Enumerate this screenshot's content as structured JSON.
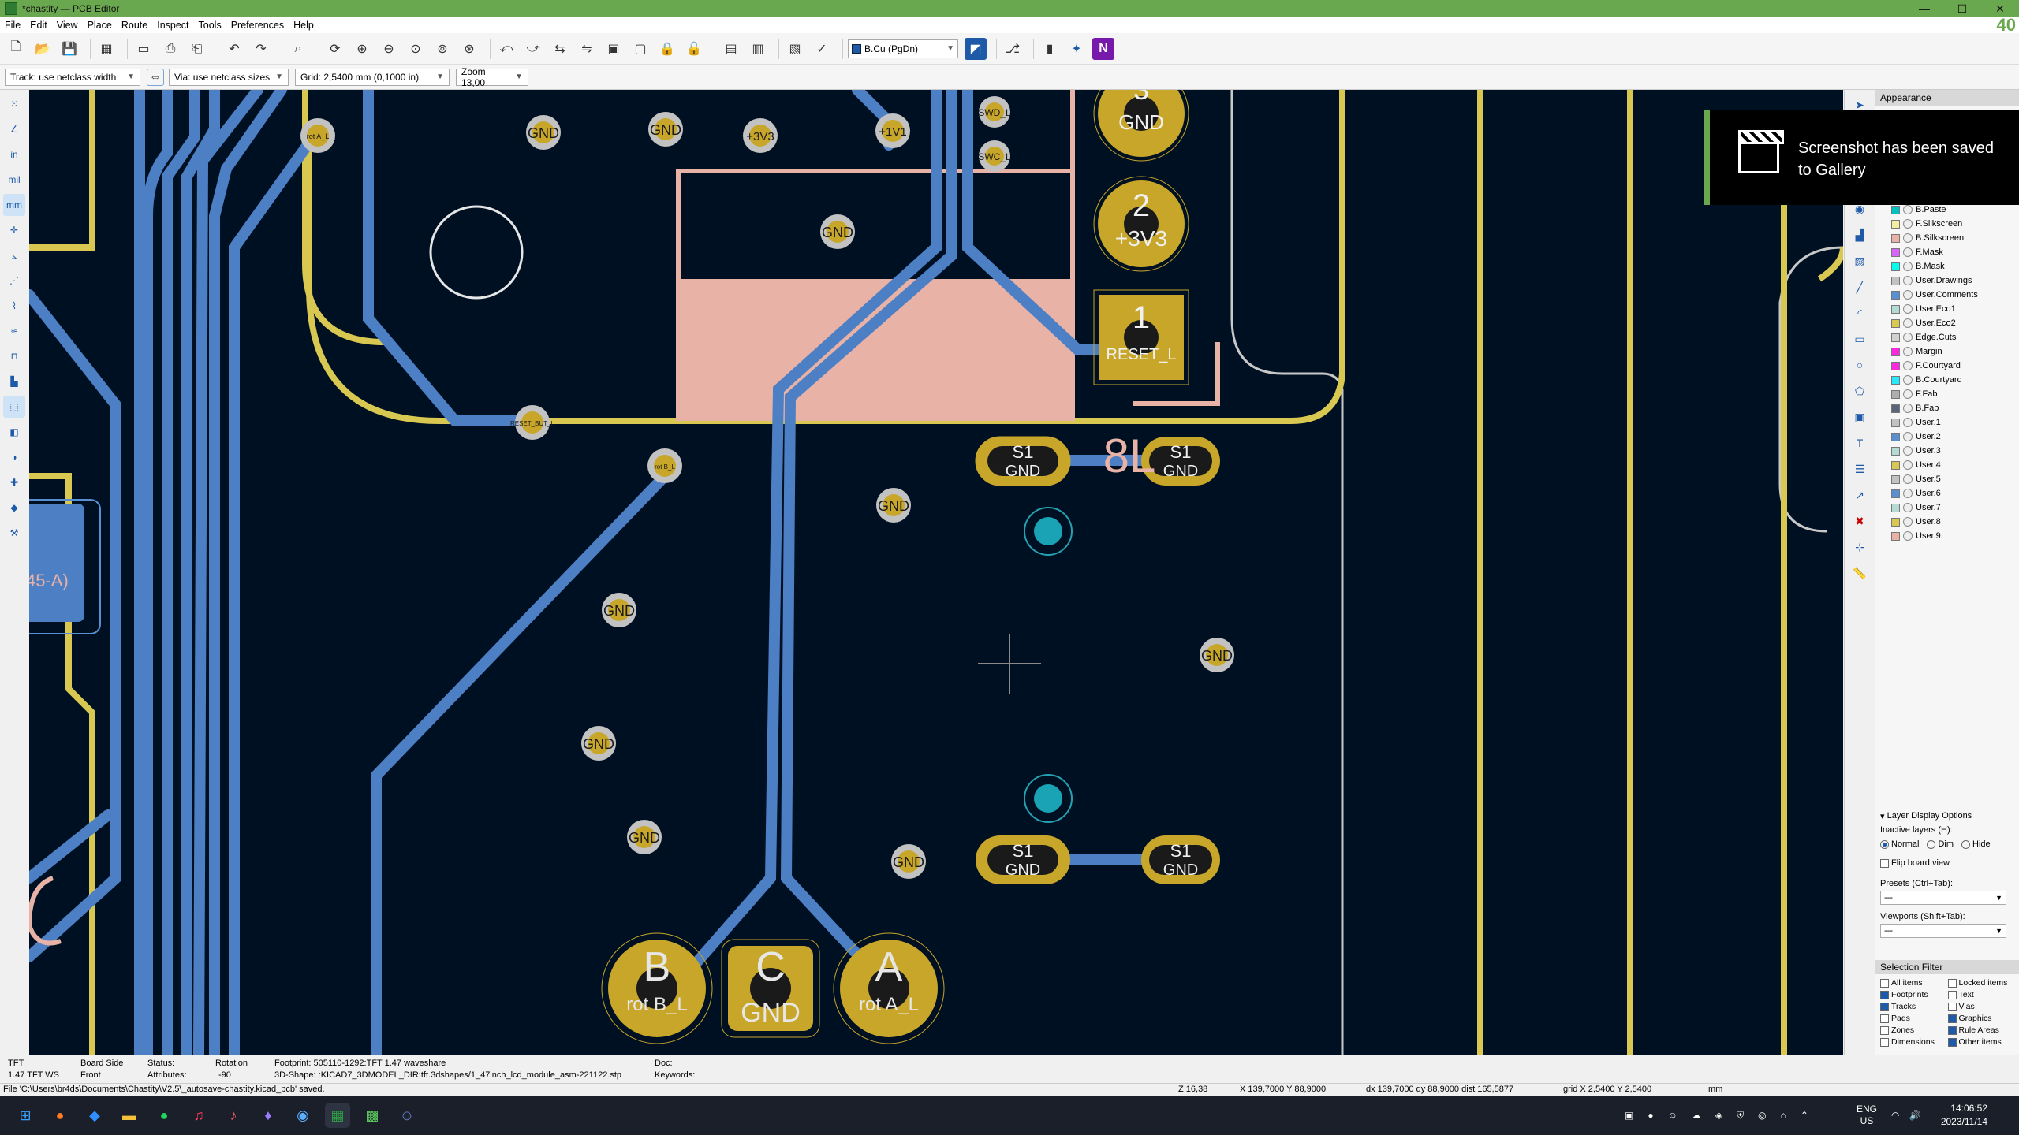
{
  "window": {
    "title": "*chastity — PCB Editor",
    "controls": [
      "—",
      "☐",
      "✕"
    ],
    "corner_number": "40"
  },
  "menu": [
    "File",
    "Edit",
    "View",
    "Place",
    "Route",
    "Inspect",
    "Tools",
    "Preferences",
    "Help"
  ],
  "toolbar": {
    "active_layer": "B.Cu (PgDn)"
  },
  "toolbar2": {
    "track": "Track: use netclass width",
    "via": "Via: use netclass sizes",
    "grid": "Grid: 2,5400 mm (0,1000 in)",
    "zoom": "Zoom 13,00"
  },
  "left_tools": {
    "units": [
      "in",
      "mil",
      "mm"
    ]
  },
  "pcb": {
    "vias_gnd": [
      "GND",
      "GND",
      "GND",
      "GND",
      "GND",
      "GND",
      "GND",
      "GND",
      "GND"
    ],
    "via_labels": [
      "+3V3",
      "+1V1",
      "SWD_L",
      "SWC_L",
      "rot A_L",
      "RESET_BUT_L",
      "rot B_L"
    ],
    "pads_right": [
      {
        "num": "3",
        "net": "GND"
      },
      {
        "num": "2",
        "net": "+3V3"
      },
      {
        "num": "1",
        "net": "RESET_L"
      }
    ],
    "switch_pads": [
      {
        "num": "S1",
        "net": "GND"
      },
      {
        "num": "S1",
        "net": "GND"
      },
      {
        "num": "S1",
        "net": "GND"
      },
      {
        "num": "S1",
        "net": "GND"
      }
    ],
    "silk_label": "8L",
    "encoder_pads": [
      {
        "num": "B",
        "net": "rot B_L"
      },
      {
        "num": "C",
        "net": "GND"
      },
      {
        "num": "A",
        "net": "rot A_L"
      }
    ],
    "left_label": "45-A)"
  },
  "toast": {
    "line1": "Screenshot has been saved",
    "line2": "to Gallery"
  },
  "appearance": {
    "title": "Appearance",
    "layers": [
      {
        "name": "B.Paste",
        "color": "#00c2c2"
      },
      {
        "name": "F.Silkscreen",
        "color": "#f2eda1"
      },
      {
        "name": "B.Silkscreen",
        "color": "#e8b2a7"
      },
      {
        "name": "F.Mask",
        "color": "#d864ff"
      },
      {
        "name": "B.Mask",
        "color": "#02ffee"
      },
      {
        "name": "User.Drawings",
        "color": "#c2c2c2"
      },
      {
        "name": "User.Comments",
        "color": "#5990d4"
      },
      {
        "name": "User.Eco1",
        "color": "#b4dbd2"
      },
      {
        "name": "User.Eco2",
        "color": "#d8c852"
      },
      {
        "name": "Edge.Cuts",
        "color": "#d0d2cd"
      },
      {
        "name": "Margin",
        "color": "#ff26e2"
      },
      {
        "name": "F.Courtyard",
        "color": "#ff26e2"
      },
      {
        "name": "B.Courtyard",
        "color": "#26e9ff"
      },
      {
        "name": "F.Fab",
        "color": "#afafaf"
      },
      {
        "name": "B.Fab",
        "color": "#58657b"
      },
      {
        "name": "User.1",
        "color": "#c2c2c2"
      },
      {
        "name": "User.2",
        "color": "#5990d4"
      },
      {
        "name": "User.3",
        "color": "#b4dbd2"
      },
      {
        "name": "User.4",
        "color": "#d8c852"
      },
      {
        "name": "User.5",
        "color": "#c2c2c2"
      },
      {
        "name": "User.6",
        "color": "#5990d4"
      },
      {
        "name": "User.7",
        "color": "#b4dbd2"
      },
      {
        "name": "User.8",
        "color": "#d8c852"
      },
      {
        "name": "User.9",
        "color": "#e8b2a7"
      }
    ],
    "layer_display_options": "Layer Display Options",
    "inactive_layers": "Inactive layers (H):",
    "inactive_opts": [
      "Normal",
      "Dim",
      "Hide"
    ],
    "flip_board": "Flip board view",
    "presets_label": "Presets (Ctrl+Tab):",
    "presets_value": "---",
    "viewports_label": "Viewports (Shift+Tab):",
    "viewports_value": "---"
  },
  "selection_filter": {
    "title": "Selection Filter",
    "items": [
      {
        "label": "All items",
        "checked": false
      },
      {
        "label": "Locked items",
        "checked": false
      },
      {
        "label": "Footprints",
        "checked": true
      },
      {
        "label": "Text",
        "checked": false
      },
      {
        "label": "Tracks",
        "checked": true
      },
      {
        "label": "Vias",
        "checked": false
      },
      {
        "label": "Pads",
        "checked": false
      },
      {
        "label": "Graphics",
        "checked": true
      },
      {
        "label": "Zones",
        "checked": false
      },
      {
        "label": "Rule Areas",
        "checked": true
      },
      {
        "label": "Dimensions",
        "checked": false
      },
      {
        "label": "Other items",
        "checked": true
      }
    ]
  },
  "info": {
    "ref": "TFT",
    "value": "1.47 TFT WS",
    "board_side_label": "Board Side",
    "board_side": "Front",
    "status_label": "Status:",
    "attributes_label": "Attributes:",
    "rotation_label": "Rotation",
    "rotation": "-90",
    "footprint": "Footprint: 505110-1292:TFT 1.47 waveshare",
    "shape": "3D-Shape: :KICAD7_3DMODEL_DIR:tft.3dshapes/1_47inch_lcd_module_asm-221122.stp",
    "doc_label": "Doc:",
    "keywords_label": "Keywords:"
  },
  "status": {
    "message": "File 'C:\\Users\\br4ds\\Documents\\Chastity\\V2.5\\_autosave-chastity.kicad_pcb' saved.",
    "z": "Z 16,38",
    "xy": "X 139,7000  Y 88,9000",
    "dxy": "dx 139,7000  dy 88,9000  dist 165,5877",
    "grid": "grid X 2,5400  Y 2,5400",
    "units": "mm"
  },
  "taskbar": {
    "lang": "ENG",
    "region": "US",
    "time": "14:06:52",
    "date": "2023/11/14"
  }
}
